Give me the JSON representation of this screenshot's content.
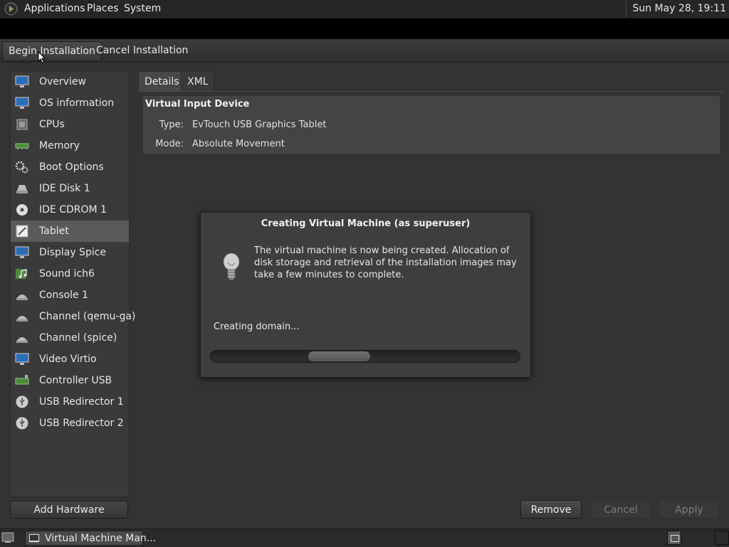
{
  "top_panel": {
    "menus": [
      "Applications",
      "Places",
      "System"
    ],
    "clock": "Sun May 28, 19:11"
  },
  "toolbar": {
    "begin_installation": "Begin Installation",
    "cancel_installation": "Cancel Installation"
  },
  "hardware_list": [
    {
      "label": "Overview",
      "icon": "monitor-icon"
    },
    {
      "label": "OS information",
      "icon": "monitor-icon"
    },
    {
      "label": "CPUs",
      "icon": "cpu-icon"
    },
    {
      "label": "Memory",
      "icon": "memory-icon"
    },
    {
      "label": "Boot Options",
      "icon": "gears-icon"
    },
    {
      "label": "IDE Disk 1",
      "icon": "disk-icon"
    },
    {
      "label": "IDE CDROM 1",
      "icon": "cdrom-icon"
    },
    {
      "label": "Tablet",
      "icon": "tablet-icon",
      "selected": true
    },
    {
      "label": "Display Spice",
      "icon": "monitor-icon"
    },
    {
      "label": "Sound ich6",
      "icon": "sound-icon"
    },
    {
      "label": "Console 1",
      "icon": "serial-icon"
    },
    {
      "label": "Channel (qemu-ga)",
      "icon": "serial-icon"
    },
    {
      "label": "Channel (spice)",
      "icon": "serial-icon"
    },
    {
      "label": "Video Virtio",
      "icon": "monitor-icon"
    },
    {
      "label": "Controller USB",
      "icon": "controller-icon"
    },
    {
      "label": "USB Redirector 1",
      "icon": "usb-icon"
    },
    {
      "label": "USB Redirector 2",
      "icon": "usb-icon"
    }
  ],
  "add_hardware": "Add Hardware",
  "tabs": {
    "details": "Details",
    "xml": "XML"
  },
  "device": {
    "title": "Virtual Input Device",
    "type_label": "Type:",
    "type_value": "EvTouch USB Graphics Tablet",
    "mode_label": "Mode:",
    "mode_value": "Absolute Movement"
  },
  "buttons": {
    "remove": "Remove",
    "cancel": "Cancel",
    "apply": "Apply"
  },
  "dialog": {
    "title": "Creating Virtual Machine (as superuser)",
    "message": "The virtual machine is now being created. Allocation of disk storage and retrieval of the installation images may take a few minutes to complete.",
    "status": "Creating domain...",
    "icon": "lightbulb-icon"
  },
  "taskbar": {
    "task_label": "Virtual Machine Man..."
  },
  "colors": {
    "background": "#333333",
    "panel": "#262626",
    "selected_row": "#5a5a5a"
  }
}
